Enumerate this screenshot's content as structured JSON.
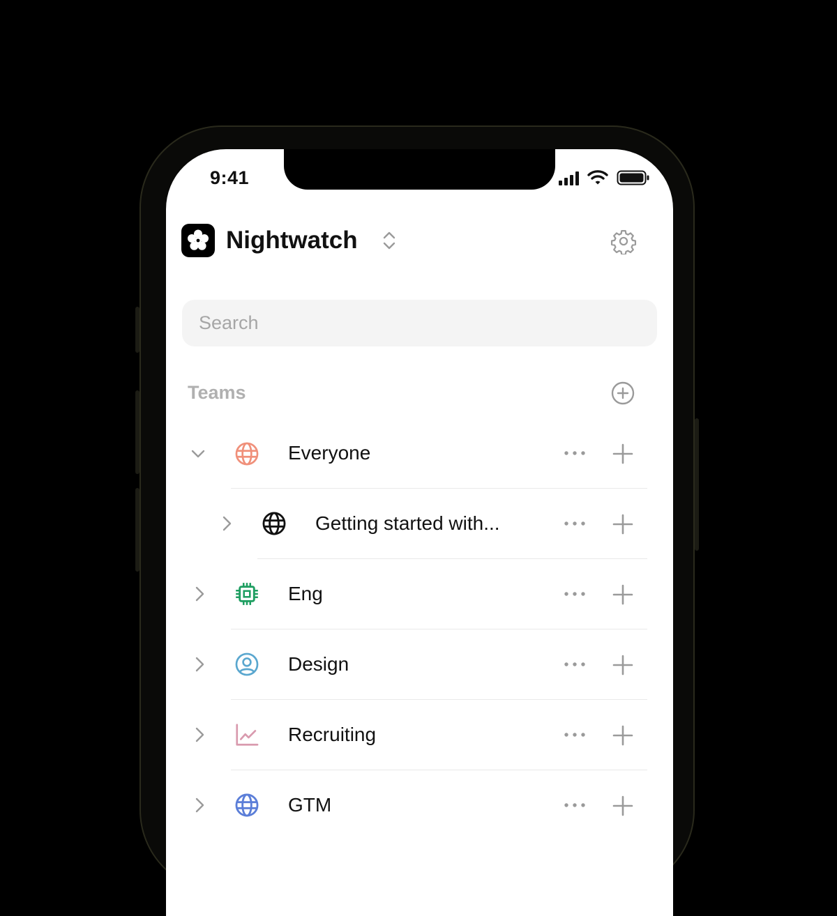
{
  "status_bar": {
    "time": "9:41"
  },
  "header": {
    "app_name": "Nightwatch",
    "logo_icon": "flower-logo-icon"
  },
  "search": {
    "placeholder": "Search"
  },
  "teams_section": {
    "label": "Teams"
  },
  "teams": [
    {
      "name": "Everyone",
      "icon": "globe-icon",
      "color": "#f0907a",
      "expanded": true,
      "level": 0
    },
    {
      "name": "Getting started with...",
      "icon": "globe-icon",
      "color": "#111111",
      "expanded": false,
      "level": 1
    },
    {
      "name": "Eng",
      "icon": "chip-icon",
      "color": "#1e9e61",
      "expanded": false,
      "level": 0
    },
    {
      "name": "Design",
      "icon": "user-circle-icon",
      "color": "#5aa7cf",
      "expanded": false,
      "level": 0
    },
    {
      "name": "Recruiting",
      "icon": "line-chart-icon",
      "color": "#d99aae",
      "expanded": false,
      "level": 0
    },
    {
      "name": "GTM",
      "icon": "globe-icon",
      "color": "#5b7ed8",
      "expanded": false,
      "level": 0
    }
  ]
}
